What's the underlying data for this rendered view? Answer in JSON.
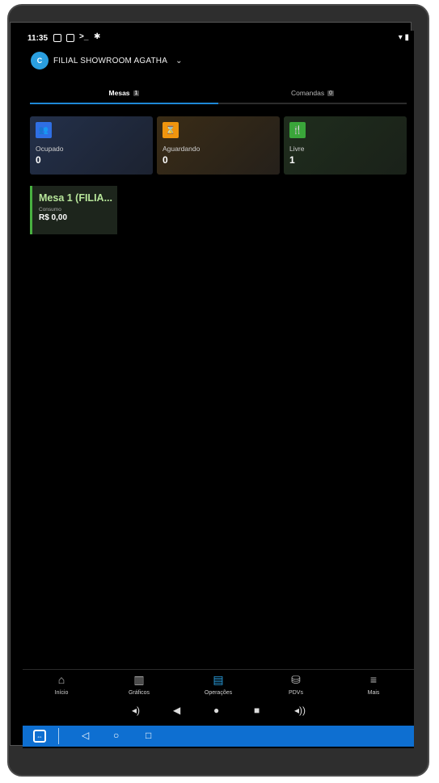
{
  "status_bar": {
    "time": "11:35",
    "right_icons": "▾ ▮"
  },
  "header": {
    "logo_text": "C",
    "branch_name": "FILIAL SHOWROOM AGATHA",
    "chevron": "⌄"
  },
  "tabs": [
    {
      "label": "Mesas",
      "count": "1",
      "active": true
    },
    {
      "label": "Comandas",
      "count": "0",
      "active": false
    }
  ],
  "status_cards": [
    {
      "label": "Ocupado",
      "value": "0",
      "icon": "people-icon",
      "color": "#2f6fe4"
    },
    {
      "label": "Aguardando",
      "value": "0",
      "icon": "hourglass-icon",
      "color": "#f0950e"
    },
    {
      "label": "Livre",
      "value": "1",
      "icon": "cutlery-icon",
      "color": "#3aa63a"
    }
  ],
  "table_card": {
    "name": "Mesa 1 (FILIA...",
    "sub_label": "Consumo",
    "value": "R$ 0,00",
    "accent_color": "#48b040"
  },
  "bottom_nav": [
    {
      "label": "Início",
      "icon": "home-icon",
      "glyph": "⌂"
    },
    {
      "label": "Gráficos",
      "icon": "chart-icon",
      "glyph": "▥"
    },
    {
      "label": "Operações",
      "icon": "store-icon",
      "glyph": "▤",
      "active": true
    },
    {
      "label": "PDVs",
      "icon": "pos-icon",
      "glyph": "⛁"
    },
    {
      "label": "Mais",
      "icon": "menu-icon",
      "glyph": "≡"
    }
  ],
  "system_keys": {
    "vol_down": "◂)",
    "back": "◀",
    "home": "●",
    "recents": "■",
    "vol_up": "◂))"
  },
  "teamviewer_bar": {
    "back": "◁",
    "home": "○",
    "recents": "□",
    "accent": "#0e6fd1"
  }
}
